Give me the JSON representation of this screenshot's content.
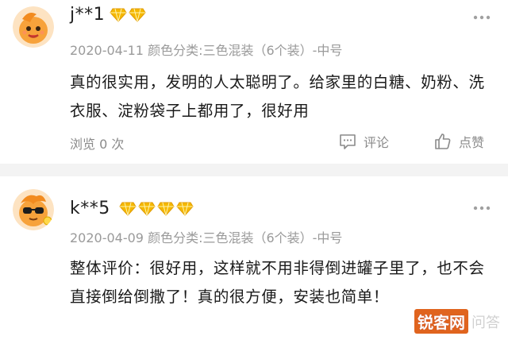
{
  "reviews": [
    {
      "username": "j**1",
      "badge_count": 2,
      "date": "2020-04-11",
      "variant": "颜色分类:三色混装（6个装）-中号",
      "text": "真的很实用，发明的人太聪明了。给家里的白糖、奶粉、洗衣服、淀粉袋子上都用了，很好用",
      "views": "浏览 0 次",
      "comment_label": "评论",
      "like_label": "点赞"
    },
    {
      "username": "k**5",
      "badge_count": 4,
      "date": "2020-04-09",
      "variant": "颜色分类:三色混装（6个装）-中号",
      "text": "整体评价：很好用，这样就不用非得倒进罐子里了，也不会直接倒给倒撒了！真的很方便，安装也简单！"
    }
  ],
  "watermark": {
    "logo": "锐客网",
    "suffix": "问答"
  },
  "colors": {
    "badge_gold": "#f5b800",
    "meta_gray": "#9a9a9a",
    "divider": "#f3f3f3",
    "avatar_orange": "#f7a23b"
  },
  "icons": {
    "more": "ellipsis-icon",
    "comment": "comment-icon",
    "like": "thumbs-up-icon",
    "badge": "diamond-badge-icon"
  }
}
